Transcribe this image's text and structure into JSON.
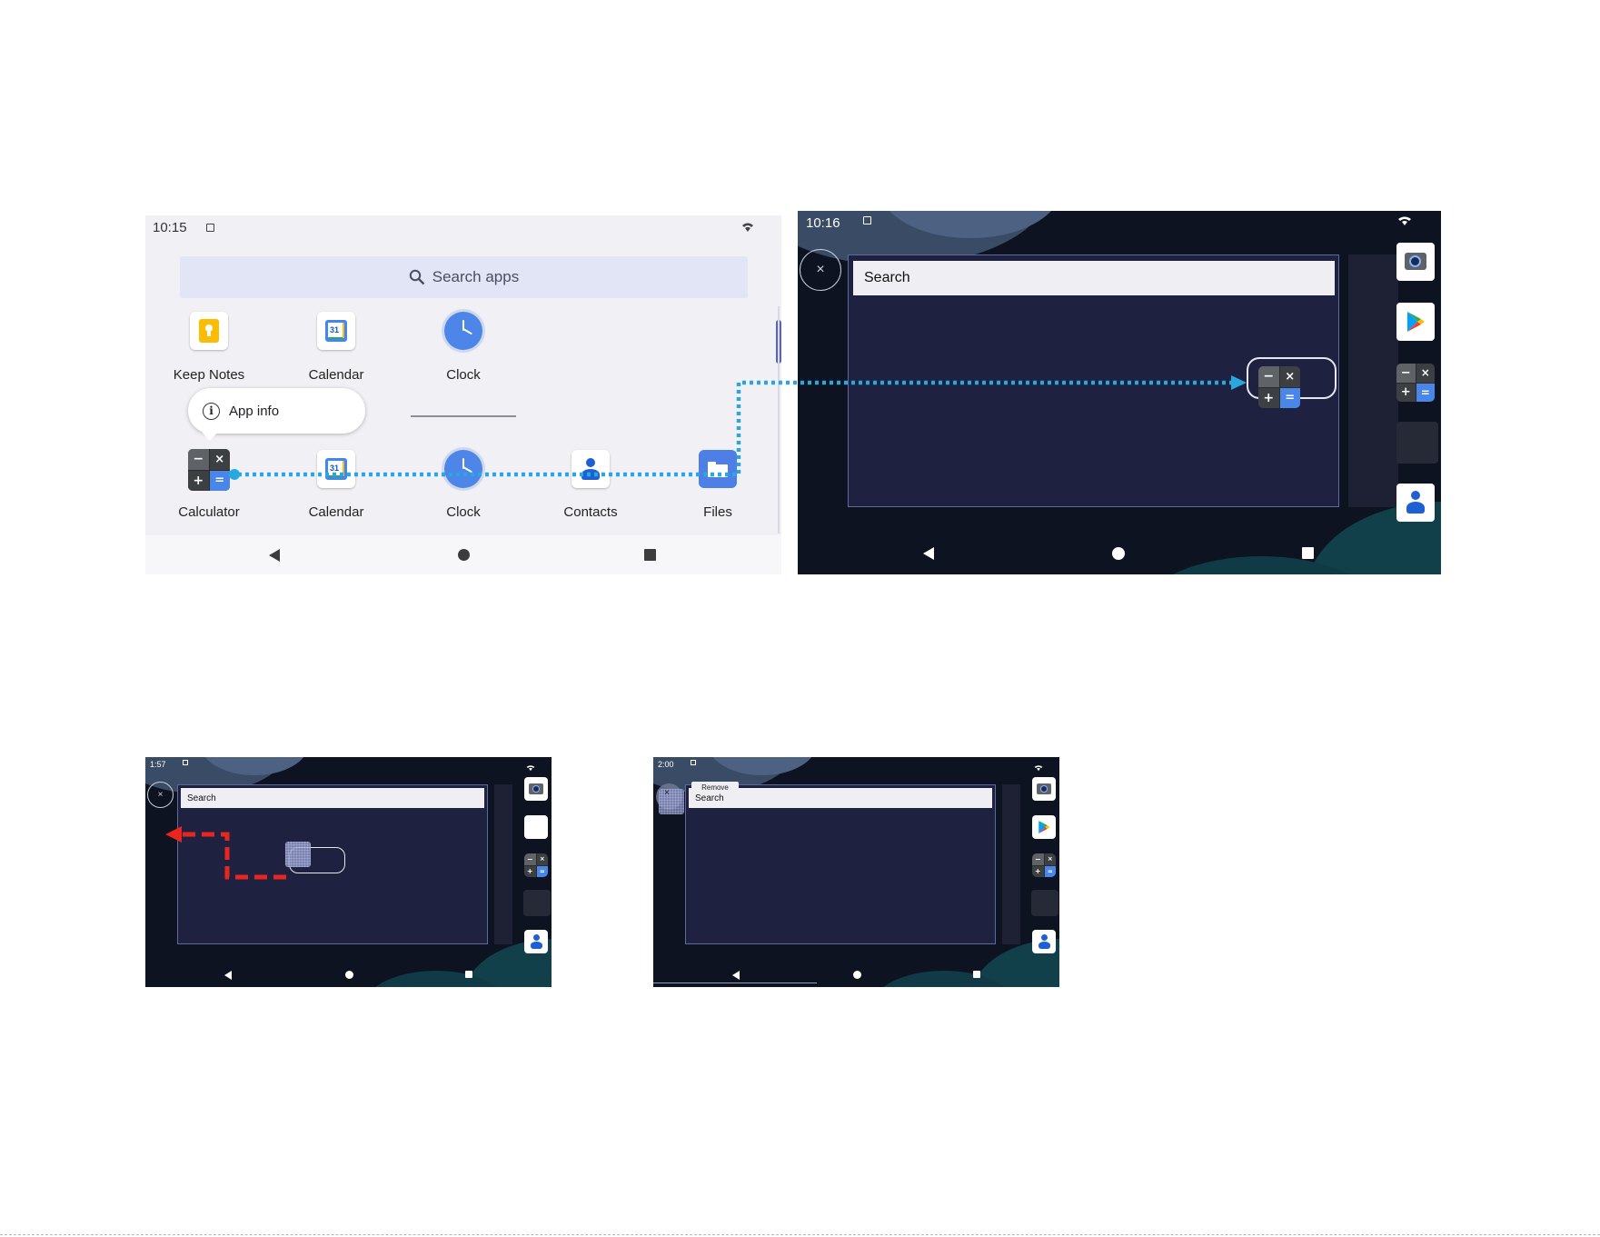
{
  "panel_a": {
    "status_time": "10:15",
    "search_placeholder": "Search apps",
    "row1": [
      {
        "label": "Keep Notes",
        "icon": "keep-notes-icon"
      },
      {
        "label": "Calendar",
        "icon": "calendar-icon"
      },
      {
        "label": "Clock",
        "icon": "clock-icon"
      }
    ],
    "popup_label": "App info",
    "row2": [
      {
        "label": "Calculator",
        "icon": "calculator-icon"
      },
      {
        "label": "Calendar",
        "icon": "calendar-icon"
      },
      {
        "label": "Clock",
        "icon": "clock-icon"
      },
      {
        "label": "Contacts",
        "icon": "contacts-icon"
      },
      {
        "label": "Files",
        "icon": "files-icon"
      }
    ],
    "calendar_day": "31"
  },
  "panel_b": {
    "status_time": "10:16",
    "close_glyph": "×",
    "search_label": "Search"
  },
  "panel_c": {
    "status_time": "1:57",
    "close_glyph": "×",
    "search_label": "Search"
  },
  "panel_d": {
    "status_time": "2:00",
    "close_glyph": "×",
    "remove_label": "Remove",
    "search_label": "Search"
  },
  "calc_keys": [
    "−",
    "×",
    "+",
    "="
  ],
  "colors": {
    "drag_path": "#29a8e0",
    "drag_left_arrow": "#e8251f",
    "drawer_bg": "#f1f0f4",
    "dark_bg": "#0d1320",
    "task_window": "#1e2240"
  }
}
